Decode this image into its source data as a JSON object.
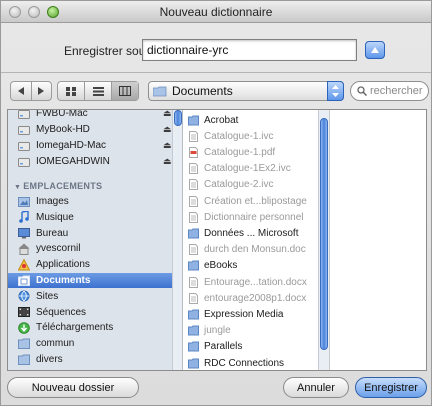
{
  "window": {
    "title": "Nouveau dictionnaire"
  },
  "save": {
    "label": "Enregistrer sous :",
    "filename": "dictionnaire-yrc"
  },
  "toolbar": {
    "location": "Documents",
    "search_placeholder": "rechercher"
  },
  "sidebar": {
    "devices": [
      {
        "label": "FWBU-Mac",
        "icon": "drive-icon",
        "eject": true
      },
      {
        "label": "MyBook-HD",
        "icon": "drive-icon",
        "eject": true
      },
      {
        "label": "IomegaHD-Mac",
        "icon": "drive-icon",
        "eject": true
      },
      {
        "label": "IOMEGAHDWIN",
        "icon": "drive-icon",
        "eject": true
      }
    ],
    "places_heading": "EMPLACEMENTS",
    "places": [
      {
        "label": "Images",
        "icon": "images-folder-icon"
      },
      {
        "label": "Musique",
        "icon": "music-folder-icon"
      },
      {
        "label": "Bureau",
        "icon": "desktop-folder-icon"
      },
      {
        "label": "yvescornil",
        "icon": "home-icon"
      },
      {
        "label": "Applications",
        "icon": "applications-icon"
      },
      {
        "label": "Documents",
        "icon": "documents-folder-icon",
        "selected": true
      },
      {
        "label": "Sites",
        "icon": "sites-icon"
      },
      {
        "label": "Séquences",
        "icon": "movies-folder-icon"
      },
      {
        "label": "Téléchargements",
        "icon": "downloads-icon"
      },
      {
        "label": "commun",
        "icon": "folder-icon"
      },
      {
        "label": "divers",
        "icon": "folder-icon"
      }
    ],
    "eject_glyph": "⏏"
  },
  "files": [
    {
      "label": "Acrobat",
      "type": "folder",
      "dim": false,
      "arrow": true
    },
    {
      "label": "Catalogue-1.ivc",
      "type": "doc",
      "dim": true,
      "arrow": false
    },
    {
      "label": "Catalogue-1.pdf",
      "type": "pdf",
      "dim": true,
      "arrow": false
    },
    {
      "label": "Catalogue-1Ex2.ivc",
      "type": "doc",
      "dim": true,
      "arrow": false
    },
    {
      "label": "Catalogue-2.ivc",
      "type": "doc",
      "dim": true,
      "arrow": false
    },
    {
      "label": "Création et...blipostage",
      "type": "doc",
      "dim": true,
      "arrow": true
    },
    {
      "label": "Dictionnaire personnel",
      "type": "doc",
      "dim": true,
      "arrow": false
    },
    {
      "label": "Données ... Microsoft",
      "type": "folder",
      "dim": false,
      "arrow": true
    },
    {
      "label": "durch den Monsun.doc",
      "type": "doc",
      "dim": true,
      "arrow": false
    },
    {
      "label": "eBooks",
      "type": "folder",
      "dim": false,
      "arrow": true
    },
    {
      "label": "Entourage...tation.docx",
      "type": "doc",
      "dim": true,
      "arrow": false
    },
    {
      "label": "entourage2008p1.docx",
      "type": "doc",
      "dim": true,
      "arrow": false
    },
    {
      "label": "Expression Media",
      "type": "folder",
      "dim": false,
      "arrow": true
    },
    {
      "label": "jungle",
      "type": "folder",
      "dim": true,
      "arrow": false
    },
    {
      "label": "Parallels",
      "type": "folder",
      "dim": false,
      "arrow": true
    },
    {
      "label": "RDC Connections",
      "type": "folder",
      "dim": false,
      "arrow": true
    }
  ],
  "buttons": {
    "new_folder": "Nouveau dossier",
    "cancel": "Annuler",
    "save": "Enregistrer"
  },
  "colors": {
    "accent": "#3c71cf",
    "sidebar_bg": "#dde3ea"
  }
}
